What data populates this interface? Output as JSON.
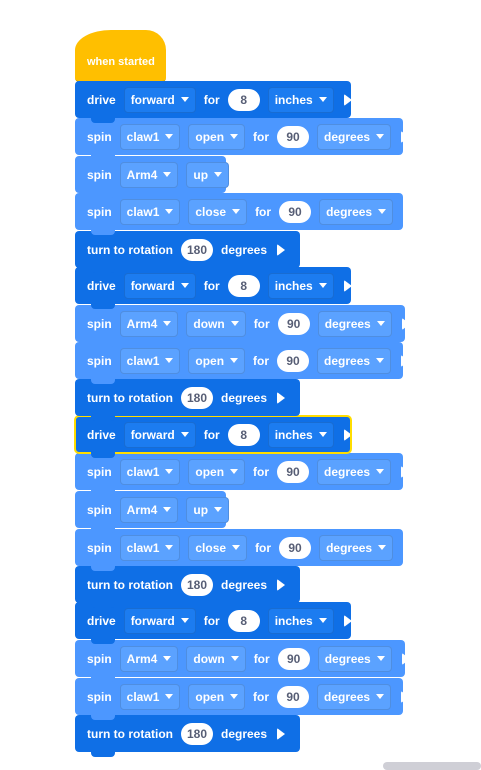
{
  "hat": {
    "label": "when started"
  },
  "blocks": [
    {
      "type": "drive",
      "kw": "drive",
      "dir": "forward",
      "for": "for",
      "value": "8",
      "unit": "inches"
    },
    {
      "type": "spin",
      "kw": "spin",
      "motor": "claw1",
      "dir": "open",
      "for": "for",
      "value": "90",
      "unit": "degrees"
    },
    {
      "type": "spin2",
      "kw": "spin",
      "motor": "Arm4",
      "dir": "up"
    },
    {
      "type": "spin",
      "kw": "spin",
      "motor": "claw1",
      "dir": "close",
      "for": "for",
      "value": "90",
      "unit": "degrees"
    },
    {
      "type": "turn",
      "kw": "turn to rotation",
      "value": "180",
      "unit": "degrees"
    },
    {
      "type": "drive",
      "kw": "drive",
      "dir": "forward",
      "for": "for",
      "value": "8",
      "unit": "inches"
    },
    {
      "type": "spin",
      "kw": "spin",
      "motor": "Arm4",
      "dir": "down",
      "for": "for",
      "value": "90",
      "unit": "degrees"
    },
    {
      "type": "spin",
      "kw": "spin",
      "motor": "claw1",
      "dir": "open",
      "for": "for",
      "value": "90",
      "unit": "degrees"
    },
    {
      "type": "turn",
      "kw": "turn to rotation",
      "value": "180",
      "unit": "degrees"
    },
    {
      "type": "drive",
      "kw": "drive",
      "dir": "forward",
      "for": "for",
      "value": "8",
      "unit": "inches",
      "selected": true
    },
    {
      "type": "spin",
      "kw": "spin",
      "motor": "claw1",
      "dir": "open",
      "for": "for",
      "value": "90",
      "unit": "degrees"
    },
    {
      "type": "spin2",
      "kw": "spin",
      "motor": "Arm4",
      "dir": "up"
    },
    {
      "type": "spin",
      "kw": "spin",
      "motor": "claw1",
      "dir": "close",
      "for": "for",
      "value": "90",
      "unit": "degrees"
    },
    {
      "type": "turn",
      "kw": "turn to rotation",
      "value": "180",
      "unit": "degrees"
    },
    {
      "type": "drive",
      "kw": "drive",
      "dir": "forward",
      "for": "for",
      "value": "8",
      "unit": "inches"
    },
    {
      "type": "spin",
      "kw": "spin",
      "motor": "Arm4",
      "dir": "down",
      "for": "for",
      "value": "90",
      "unit": "degrees"
    },
    {
      "type": "spin",
      "kw": "spin",
      "motor": "claw1",
      "dir": "open",
      "for": "for",
      "value": "90",
      "unit": "degrees"
    },
    {
      "type": "turn",
      "kw": "turn to rotation",
      "value": "180",
      "unit": "degrees"
    }
  ],
  "colors": {
    "hat": "#ffbf00",
    "drive": "#0f6fe6",
    "spin": "#4c97ff",
    "selected": "#ffdd00"
  }
}
